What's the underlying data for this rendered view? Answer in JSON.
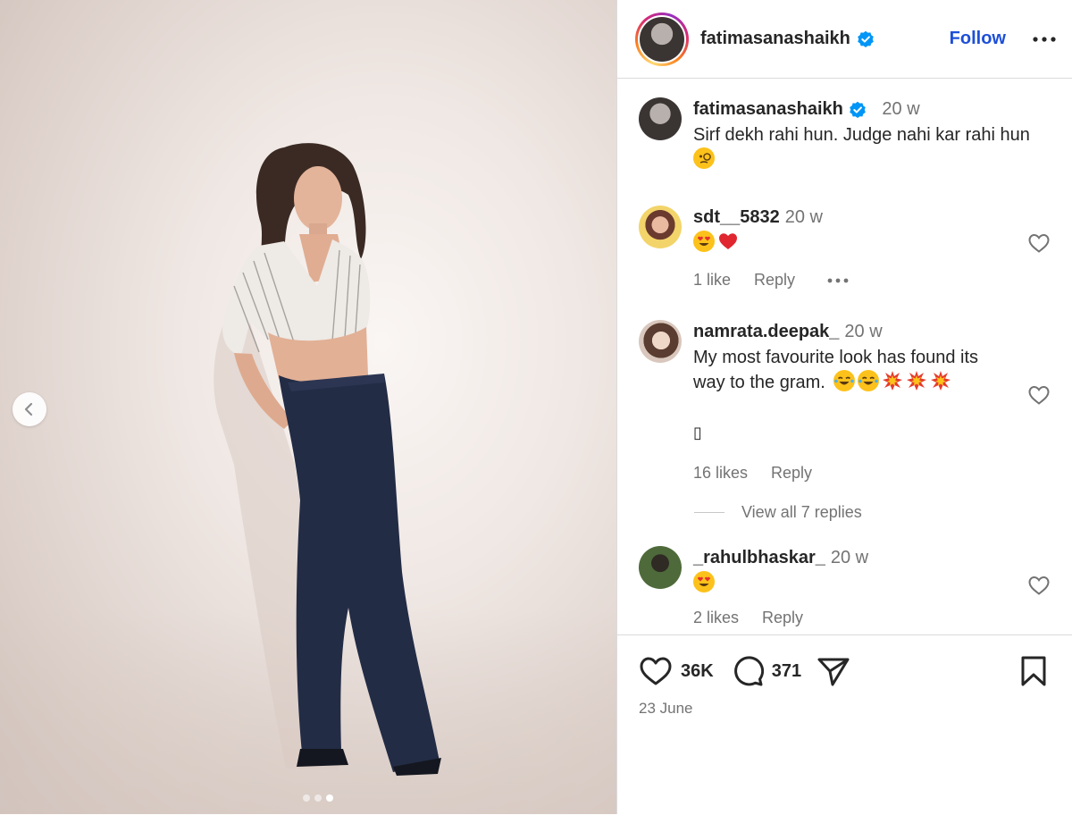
{
  "post": {
    "author": "fatimasanashaikh",
    "follow_label": "Follow",
    "image": {
      "carousel_total": 3,
      "carousel_active_index": 3
    }
  },
  "caption": {
    "username": "fatimasanashaikh",
    "time": "20 w",
    "text": "Sirf dekh rahi hun. Judge nahi kar rahi hun",
    "emoji": "monocle-face"
  },
  "comments": [
    {
      "username": "sdt__5832",
      "time": "20 w",
      "emojis": [
        "heart-eyes",
        "red-heart"
      ],
      "likes": "1 like",
      "reply_label": "Reply"
    },
    {
      "username": "namrata.deepak_",
      "time": "20 w",
      "text_line1": "My most favourite look has found its",
      "text_line2": "way to the gram.",
      "emojis": [
        "tears-of-joy",
        "tears-of-joy",
        "collision",
        "collision",
        "collision"
      ],
      "extra": "▯",
      "likes": "16 likes",
      "reply_label": "Reply",
      "view_replies": "View all 7 replies"
    },
    {
      "username": "_rahulbhaskar_",
      "time": "20 w",
      "emojis": [
        "heart-eyes"
      ],
      "likes": "2 likes",
      "reply_label": "Reply"
    }
  ],
  "actions": {
    "likes_count": "36K",
    "comments_count": "371",
    "date": "23 June"
  },
  "colors": {
    "accent": "#0095f6",
    "verified": "#0095f6",
    "text": "#262626",
    "muted": "#737373",
    "border": "#dbdbdb"
  }
}
